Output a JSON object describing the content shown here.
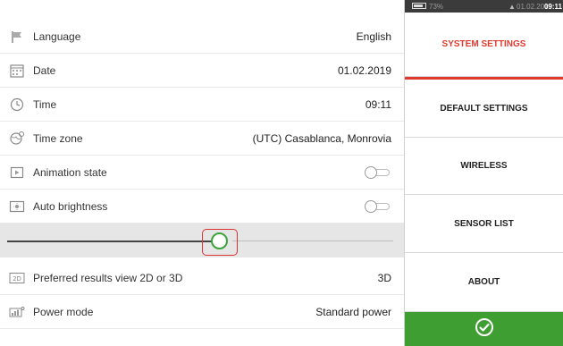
{
  "settings": {
    "rows": [
      {
        "label": "Language",
        "value": "English",
        "icon": "flag-icon"
      },
      {
        "label": "Date",
        "value": "01.02.2019",
        "icon": "calendar-icon"
      },
      {
        "label": "Time",
        "value": "09:11",
        "icon": "clock-icon"
      },
      {
        "label": "Time zone",
        "value": "(UTC) Casablanca, Monrovia",
        "icon": "globe-icon"
      },
      {
        "label": "Animation state",
        "value": "off",
        "icon": "animation-icon"
      },
      {
        "label": "Auto brightness",
        "value": "off",
        "icon": "brightness-icon"
      },
      {
        "label": "Preferred results view 2D or 3D",
        "value": "3D",
        "icon": "2d-3d-icon"
      },
      {
        "label": "Power mode",
        "value": "Standard power",
        "icon": "power-mode-icon"
      }
    ],
    "brightness_level": 0.52,
    "brightness_slider_highlighted": true
  },
  "status_bar": {
    "battery": "73%",
    "date": "01.02.2019",
    "time": "09:11"
  },
  "menu": {
    "items": [
      {
        "label": "SYSTEM SETTINGS",
        "active": true
      },
      {
        "label": "DEFAULT SETTINGS",
        "active": false
      },
      {
        "label": "WIRELESS",
        "active": false
      },
      {
        "label": "SENSOR LIST",
        "active": false
      },
      {
        "label": "ABOUT",
        "active": false
      }
    ],
    "confirm_icon": "checkmark-circle-icon"
  },
  "colors": {
    "accent_red": "#e03a2e",
    "confirm_green": "#3e9e32",
    "slider_knob_green": "#3aa33a",
    "status_bar_bg": "#3b3b3b"
  }
}
